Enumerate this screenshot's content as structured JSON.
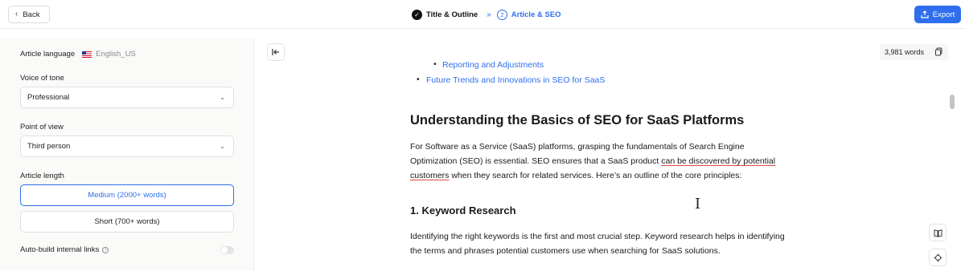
{
  "topbar": {
    "back_label": "Back",
    "steps": [
      {
        "label": "Title & Outline",
        "state": "done"
      },
      {
        "number": "2",
        "label": "Article & SEO",
        "state": "active"
      }
    ],
    "export_label": "Export",
    "accent_color": "#2f6fed"
  },
  "sidebar": {
    "language_label": "Article language",
    "language_value": "English_US",
    "voice_label": "Voice of tone",
    "voice_value": "Professional",
    "pov_label": "Point of view",
    "pov_value": "Third person",
    "length_label": "Article length",
    "length_options": [
      {
        "label": "Medium (2000+ words)",
        "selected": true
      },
      {
        "label": "Short (700+ words)",
        "selected": false
      }
    ],
    "auto_links_label": "Auto-build internal links",
    "auto_links_enabled": false
  },
  "editor": {
    "word_count": "3,981 words",
    "toc_sub_item": "Reporting and Adjustments",
    "toc_item": "Future Trends and Innovations in SEO for SaaS",
    "heading": "Understanding the Basics of SEO for SaaS Platforms",
    "para1_a": "For Software as a Service (SaaS) platforms, grasping the fundamentals of Search Engine Optimization (SEO) is essential. SEO ensures that a SaaS product ",
    "para1_underlined": "can be discovered by potential customers",
    "para1_b": " when they search for related services. Here’s an outline of the core principles:",
    "subheading": "1. Keyword Research",
    "para2": "Identifying the right keywords is the first and most crucial step. Keyword research helps in identifying the terms and phrases potential customers use when searching for SaaS solutions."
  }
}
